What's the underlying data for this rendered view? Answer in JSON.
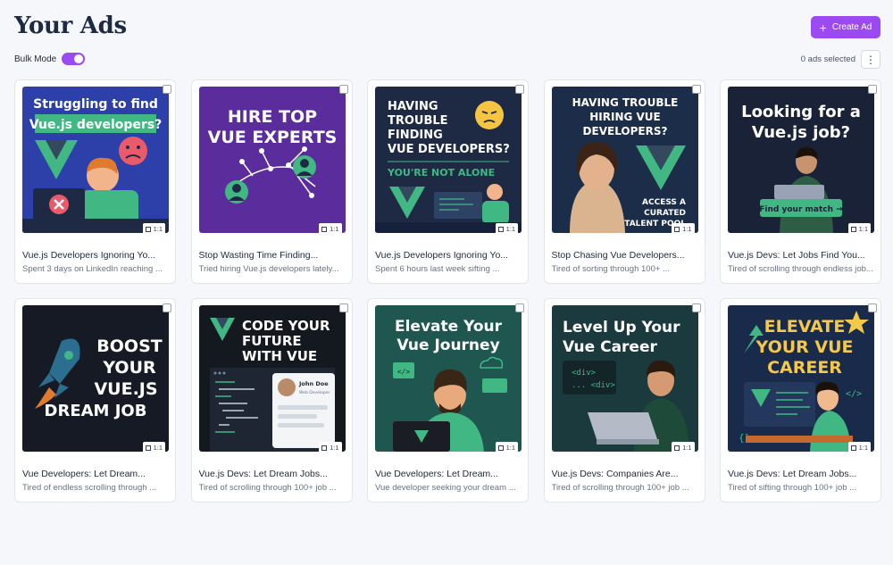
{
  "header": {
    "title": "Your Ads",
    "create_label": "Create Ad"
  },
  "toolbar": {
    "bulk_label": "Bulk Mode",
    "bulk_enabled": true,
    "selected_text": "0 ads selected"
  },
  "colors": {
    "accent": "#9b4af2",
    "vue_green": "#41b883",
    "navy": "#1e2a44"
  },
  "ads": [
    {
      "title": "Vue.js Developers Ignoring Yo...",
      "desc": "Spent 3 days on LinkedIn reaching ...",
      "ratio": "1:1",
      "image": {
        "l1": "Struggling to find",
        "l2": "Vue.js developers?"
      }
    },
    {
      "title": "Stop Wasting Time Finding...",
      "desc": "Tried hiring Vue.js developers lately...",
      "ratio": "1:1",
      "image": {
        "l1": "HIRE TOP",
        "l2": "VUE EXPERTS"
      }
    },
    {
      "title": "Vue.js Developers Ignoring Yo...",
      "desc": "Spent 6 hours last week sifting ...",
      "ratio": "1:1",
      "image": {
        "l1": "HAVING",
        "l2": "TROUBLE",
        "l3": "FINDING",
        "l4": "VUE DEVELOPERS?",
        "l5": "YOU'RE NOT ALONE"
      }
    },
    {
      "title": "Stop Chasing Vue Developers...",
      "desc": "Tired of sorting through 100+ ...",
      "ratio": "1:1",
      "image": {
        "l1": "HAVING TROUBLE",
        "l2": "HIRING VUE",
        "l3": "DEVELOPERS?",
        "l4": "ACCESS A",
        "l5": "CURATED",
        "l6": "TALENT POOL"
      }
    },
    {
      "title": "Vue.js Devs: Let Jobs Find You...",
      "desc": "Tired of scrolling through endless job...",
      "ratio": "1:1",
      "image": {
        "l1": "Looking for a",
        "l2": "Vue.js job?",
        "btn": "Find your match →"
      }
    },
    {
      "title": "Vue Developers: Let Dream...",
      "desc": "Tired of endless scrolling through ...",
      "ratio": "1:1",
      "image": {
        "l1": "BOOST",
        "l2": "YOUR",
        "l3": "VUE.JS",
        "l4": "DREAM JOB"
      }
    },
    {
      "title": "Vue.js Devs: Let Dream Jobs...",
      "desc": "Tired of scrolling through 100+ job ...",
      "ratio": "1:1",
      "image": {
        "l1": "CODE YOUR",
        "l2": "FUTURE",
        "l3": "WITH VUE",
        "name": "John Doe",
        "role": "Web Developer"
      }
    },
    {
      "title": "Vue Developers: Let Dream...",
      "desc": "Vue developer seeking your dream ...",
      "ratio": "1:1",
      "image": {
        "l1": "Elevate Your",
        "l2": "Vue Journey"
      }
    },
    {
      "title": "Vue.js Devs: Companies Are...",
      "desc": "Tired of scrolling through 100+ job ...",
      "ratio": "1:1",
      "image": {
        "l1": "Level Up Your",
        "l2": "Vue Career",
        "c1": "<div>",
        "c2": "... <div>"
      }
    },
    {
      "title": "Vue.js Devs: Let Dream Jobs...",
      "desc": "Tired of sifting through 100+ job ...",
      "ratio": "1:1",
      "image": {
        "l1": "ELEVATE",
        "l2": "YOUR VUE",
        "l3": "CAREER"
      }
    }
  ]
}
